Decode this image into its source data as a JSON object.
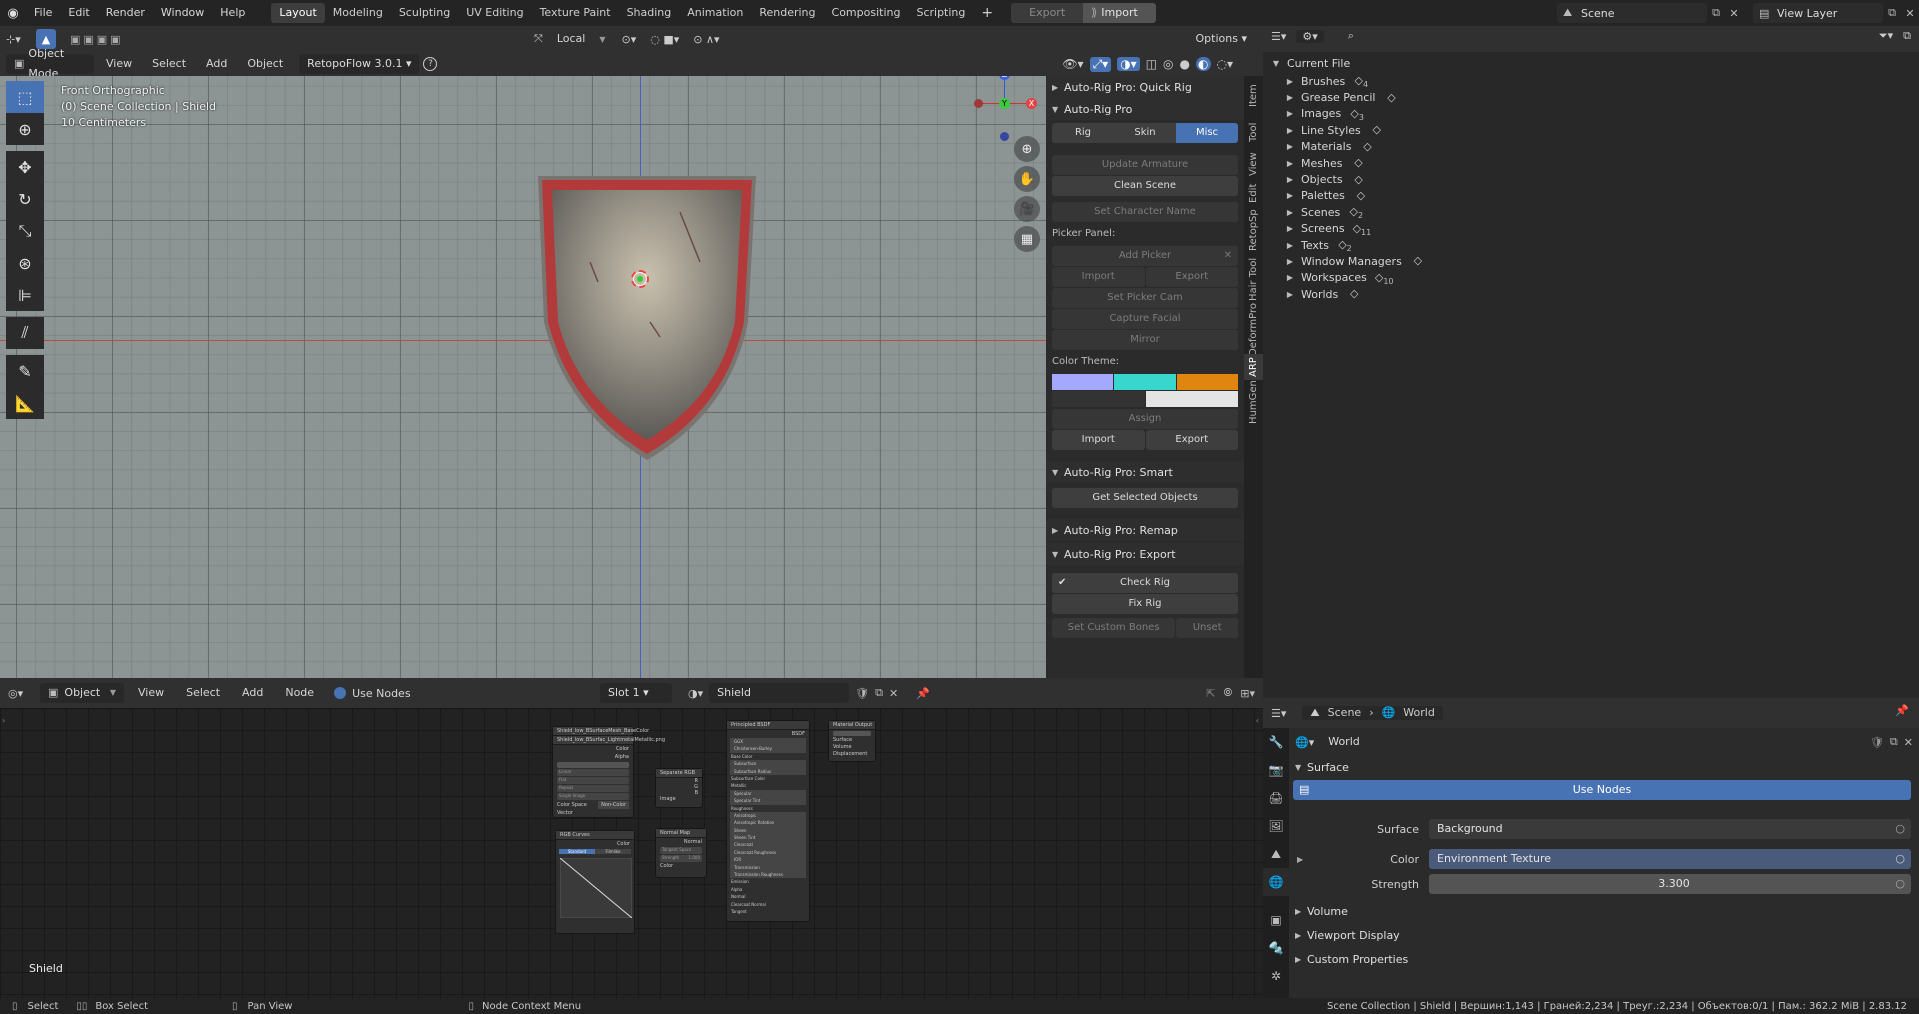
{
  "topbar": {
    "menus": [
      "File",
      "Edit",
      "Render",
      "Window",
      "Help"
    ],
    "workspaces": [
      "Layout",
      "Modeling",
      "Sculpting",
      "UV Editing",
      "Texture Paint",
      "Shading",
      "Animation",
      "Rendering",
      "Compositing",
      "Scripting"
    ],
    "active_workspace": "Layout",
    "add_tab": "+",
    "export_label": "Export",
    "import_label": "Import",
    "scene_name": "Scene",
    "view_layer": "View Layer"
  },
  "viewport_header": {
    "transform_orientation": "Local",
    "options_label": "Options",
    "mode": "Object Mode",
    "menus": [
      "View",
      "Select",
      "Add",
      "Object"
    ],
    "addon": "RetopoFlow 3.0.1"
  },
  "viewport": {
    "view_name": "Front Orthographic",
    "collection_info": "(0) Scene Collection | Shield",
    "scale_info": "10 Centimeters",
    "axis_labels": {
      "z": "Z",
      "y": "Y",
      "x": "X"
    },
    "object_name": "Shield"
  },
  "n_panel": {
    "tabs": [
      "Item",
      "Tool",
      "View",
      "Edit",
      "RetopSp",
      "Hair Tool",
      "DeformPro",
      "ARP",
      "HumGen"
    ],
    "active_tab": "ARP",
    "quick_rig": "Auto-Rig Pro: Quick Rig",
    "arp_title": "Auto-Rig Pro",
    "arp_tabs": [
      "Rig",
      "Skin",
      "Misc"
    ],
    "active_arp_tab": "Misc",
    "update_armature": "Update Armature",
    "clean_scene": "Clean Scene",
    "set_character_name": "Set Character Name",
    "picker_panel": "Picker Panel:",
    "add_picker": "Add Picker",
    "import": "Import",
    "export": "Export",
    "set_picker_cam": "Set Picker Cam",
    "capture_facial": "Capture Facial",
    "mirror": "Mirror",
    "color_theme": "Color Theme:",
    "theme_colors": [
      "#a5a8ff",
      "#38d6cd",
      "#e0850f",
      "#333333",
      "#e4e4e4"
    ],
    "assign": "Assign",
    "smart": "Auto-Rig Pro: Smart",
    "get_selected_objects": "Get Selected Objects",
    "remap": "Auto-Rig Pro: Remap",
    "export_panel": "Auto-Rig Pro: Export",
    "check_rig": "Check Rig",
    "fix_rig": "Fix Rig",
    "set_custom_bones": "Set Custom Bones",
    "unset": "Unset"
  },
  "outliner": {
    "root": "Current File",
    "items": [
      {
        "label": "Brushes",
        "icon": "brush-icon",
        "badge": "4"
      },
      {
        "label": "Grease Pencil",
        "icon": "grease-pencil-icon",
        "badge": ""
      },
      {
        "label": "Images",
        "icon": "image-icon",
        "badge": "3"
      },
      {
        "label": "Line Styles",
        "icon": "line-style-icon",
        "badge": ""
      },
      {
        "label": "Materials",
        "icon": "material-icon",
        "badge": ""
      },
      {
        "label": "Meshes",
        "icon": "mesh-icon",
        "badge": ""
      },
      {
        "label": "Objects",
        "icon": "object-icon",
        "badge": ""
      },
      {
        "label": "Palettes",
        "icon": "palette-icon",
        "badge": ""
      },
      {
        "label": "Scenes",
        "icon": "scene-icon",
        "badge": "2"
      },
      {
        "label": "Screens",
        "icon": "screen-icon",
        "badge": "11"
      },
      {
        "label": "Texts",
        "icon": "text-icon",
        "badge": "2"
      },
      {
        "label": "Window Managers",
        "icon": "window-manager-icon",
        "badge": ""
      },
      {
        "label": "Workspaces",
        "icon": "workspace-icon",
        "badge": "10"
      },
      {
        "label": "Worlds",
        "icon": "world-icon",
        "badge": ""
      }
    ]
  },
  "node_editor": {
    "object_type": "Object",
    "menus": [
      "View",
      "Select",
      "Add",
      "Node"
    ],
    "use_nodes": "Use Nodes",
    "slot": "Slot 1",
    "material": "Shield",
    "nodes": {
      "image_tex1": "Shield_low_BSurfaceMesh_BaseColor",
      "image_tex2": "Shield_low_BSurfac_LightmetalMetallic.png",
      "separate": "Separate RGB",
      "bsdf": "Principled BSDF",
      "bsdf_out": "BSDF",
      "output": "Material Output",
      "output_sockets": [
        "Surface",
        "Volume",
        "Displacement"
      ],
      "curves": "RGB Curves",
      "normal_map": "Normal Map",
      "normal_out": "Normal",
      "bsdf_inputs": [
        "GGX",
        "Christensen-Burley",
        "Base Color",
        "Subsurface",
        "Subsurface Radius",
        "Subsurface Color",
        "Metallic",
        "Specular",
        "Specular Tint",
        "Roughness",
        "Anisotropic",
        "Anisotropic Rotation",
        "Sheen",
        "Sheen Tint",
        "Clearcoat",
        "Clearcoat Roughness",
        "IOR",
        "Transmission",
        "Transmission Roughness",
        "Emission",
        "Alpha",
        "Normal",
        "Clearcoat Normal",
        "Tangent"
      ],
      "image_sockets": [
        "Color",
        "Alpha"
      ],
      "image_fields": [
        "Linear",
        "Flat",
        "Repeat",
        "Single Image"
      ],
      "color_space": "Color Space",
      "color_space_value": "Non-Color",
      "vector": "Vector",
      "sep_out": [
        "R",
        "G",
        "B"
      ],
      "sep_in": "Image",
      "curves_color": "Color",
      "curves_tabs": [
        "Standard",
        "Filmlike"
      ],
      "normal_space": "Tangent Space",
      "normal_strength": "Strength",
      "normal_strength_val": "1.000",
      "normal_color": "Color"
    },
    "corner_label": "Shield"
  },
  "properties": {
    "scene": "Scene",
    "world_crumb": "World",
    "world_name": "World",
    "surface_panel": "Surface",
    "use_nodes_btn": "Use Nodes",
    "surface_label": "Surface",
    "surface_value": "Background",
    "color_label": "Color",
    "color_value": "Environment Texture",
    "strength_label": "Strength",
    "strength_value": "3.300",
    "volume": "Volume",
    "viewport_display": "Viewport Display",
    "custom_properties": "Custom Properties"
  },
  "status_bar": {
    "select": "Select",
    "box_select": "Box Select",
    "pan_view": "Pan View",
    "node_context": "Node Context Menu",
    "stats": "Scene Collection | Shield | Вершин:1,143 | Граней:2,234 | Треуг.:2,234 | Объектов:0/1 | Пам.: 362.2 МiB | 2.83.12"
  }
}
